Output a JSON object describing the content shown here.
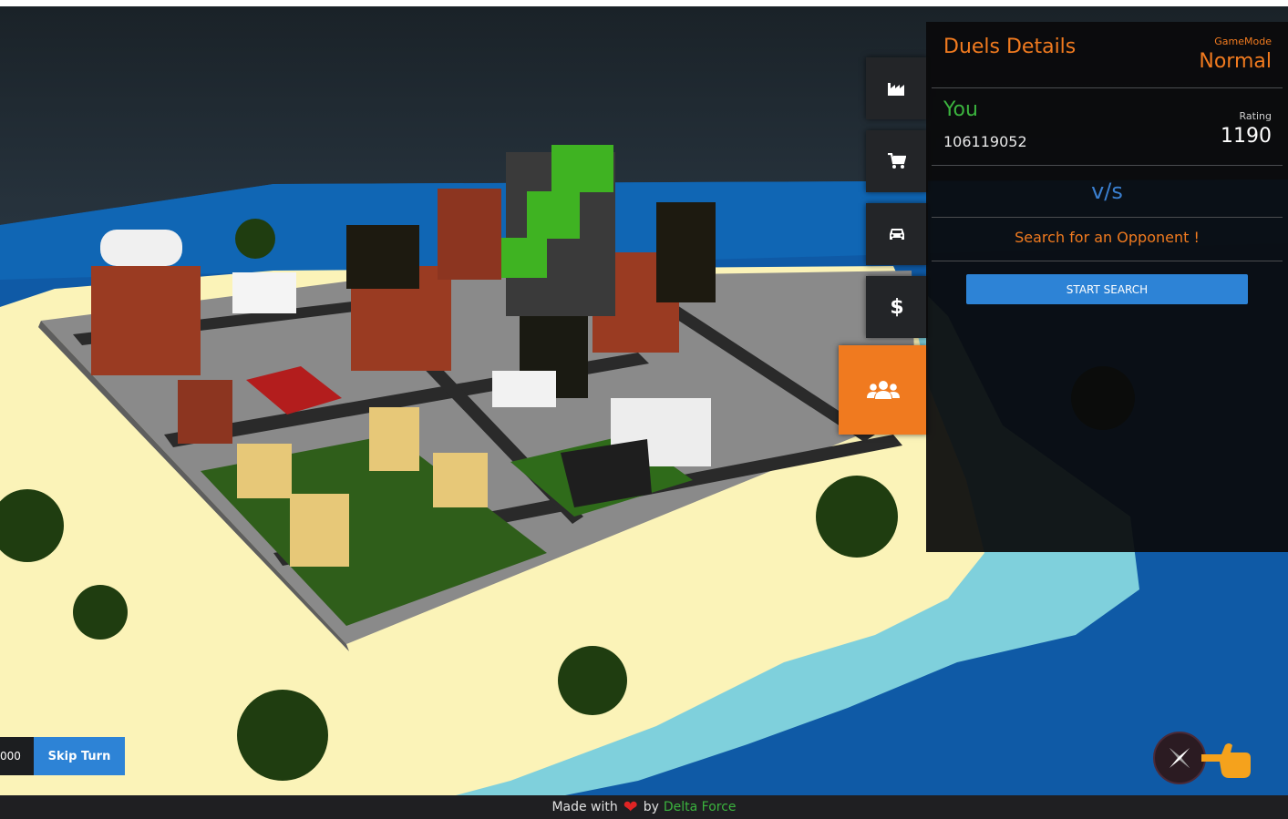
{
  "side_menu": {
    "items": [
      {
        "icon": "industry-icon",
        "label": "Industry"
      },
      {
        "icon": "cart-icon",
        "label": "Shop"
      },
      {
        "icon": "car-icon",
        "label": "Vehicles"
      },
      {
        "icon": "dollar-icon",
        "label": "Money"
      },
      {
        "icon": "users-icon",
        "label": "Duels",
        "active": true
      }
    ],
    "active_color": "#f07a1f"
  },
  "duels": {
    "title": "Duels Details",
    "gamemode_label": "GameMode",
    "gamemode_value": "Normal",
    "player_label": "You",
    "player_id": "106119052",
    "rating_label": "Rating",
    "rating_value": "1190",
    "vs_text": "v/s",
    "search_message": "Search for an Opponent !",
    "start_button": "START SEARCH"
  },
  "controls": {
    "money_partial": "000",
    "skip_turn": "Skip Turn"
  },
  "icons": {
    "compass": "compass-icon",
    "hand": "hand-pointer-icon"
  },
  "footer": {
    "made_with": "Made with",
    "by": "by",
    "team": "Delta Force"
  },
  "colors": {
    "accent_orange": "#f07a1f",
    "accent_blue": "#2d83d6",
    "accent_green": "#3bb33e",
    "panel_bg": "#0a0a0b"
  }
}
